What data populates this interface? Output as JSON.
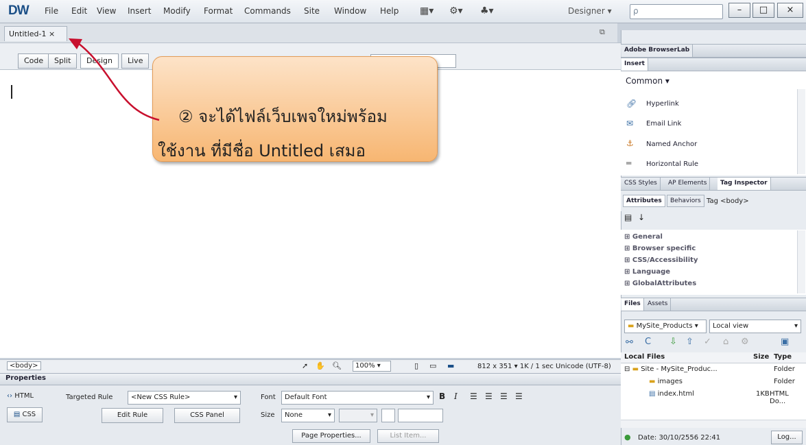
{
  "app": {
    "logo": "DW",
    "menus": [
      "File",
      "Edit",
      "View",
      "Insert",
      "Modify",
      "Format",
      "Commands",
      "Site",
      "Window",
      "Help"
    ],
    "workspace": "Designer",
    "search_placeholder": "ρ"
  },
  "window_buttons": {
    "minimize": "–",
    "maximize": "□",
    "close": "×"
  },
  "document": {
    "tab_label": "Untitled-1",
    "tab_close": "×",
    "view_buttons": [
      "Code",
      "Split",
      "Design",
      "Live"
    ]
  },
  "callout": {
    "line1": "② จะได้ไฟล์เว็บเพจใหม่พร้อม",
    "line2": "ใช้งาน ที่มีชื่อ Untitled เสมอ"
  },
  "status": {
    "tag": "<body>",
    "zoom": "100%",
    "info": "812 x 351 ▾ 1K / 1 sec Unicode (UTF-8)"
  },
  "properties": {
    "title": "Properties",
    "html_btn": "HTML",
    "css_btn": "CSS",
    "targeted_label": "Targeted Rule",
    "targeted_value": "<New CSS Rule>",
    "edit_rule": "Edit Rule",
    "css_panel": "CSS Panel",
    "font_label": "Font",
    "font_value": "Default Font",
    "size_label": "Size",
    "size_value": "None",
    "page_props": "Page Properties...",
    "list_item": "List Item..."
  },
  "panels": {
    "browserlab": "Adobe BrowserLab",
    "insert_tab": "Insert",
    "insert_category": "Common",
    "insert_items": [
      "Hyperlink",
      "Email Link",
      "Named Anchor",
      "Horizontal Rule"
    ],
    "css_tabs": [
      "CSS Styles",
      "AP Elements",
      "Tag Inspector"
    ],
    "tag_subtabs": [
      "Attributes",
      "Behaviors"
    ],
    "tag_label": "Tag <body>",
    "tag_groups": [
      "General",
      "Browser specific",
      "CSS/Accessibility",
      "Language",
      "GlobalAttributes"
    ],
    "files_tabs": [
      "Files",
      "Assets"
    ],
    "site_name": "MySite_Products",
    "view_mode": "Local view",
    "files_headers": {
      "name": "Local Files",
      "size": "Size",
      "type": "Type"
    },
    "files": [
      {
        "name": "Site - MySite_Produc...",
        "size": "",
        "type": "Folder"
      },
      {
        "name": "images",
        "size": "",
        "type": "Folder"
      },
      {
        "name": "index.html",
        "size": "1KB",
        "type": "HTML Do..."
      }
    ],
    "date": "Date: 30/10/2556 22:41",
    "log": "Log..."
  }
}
